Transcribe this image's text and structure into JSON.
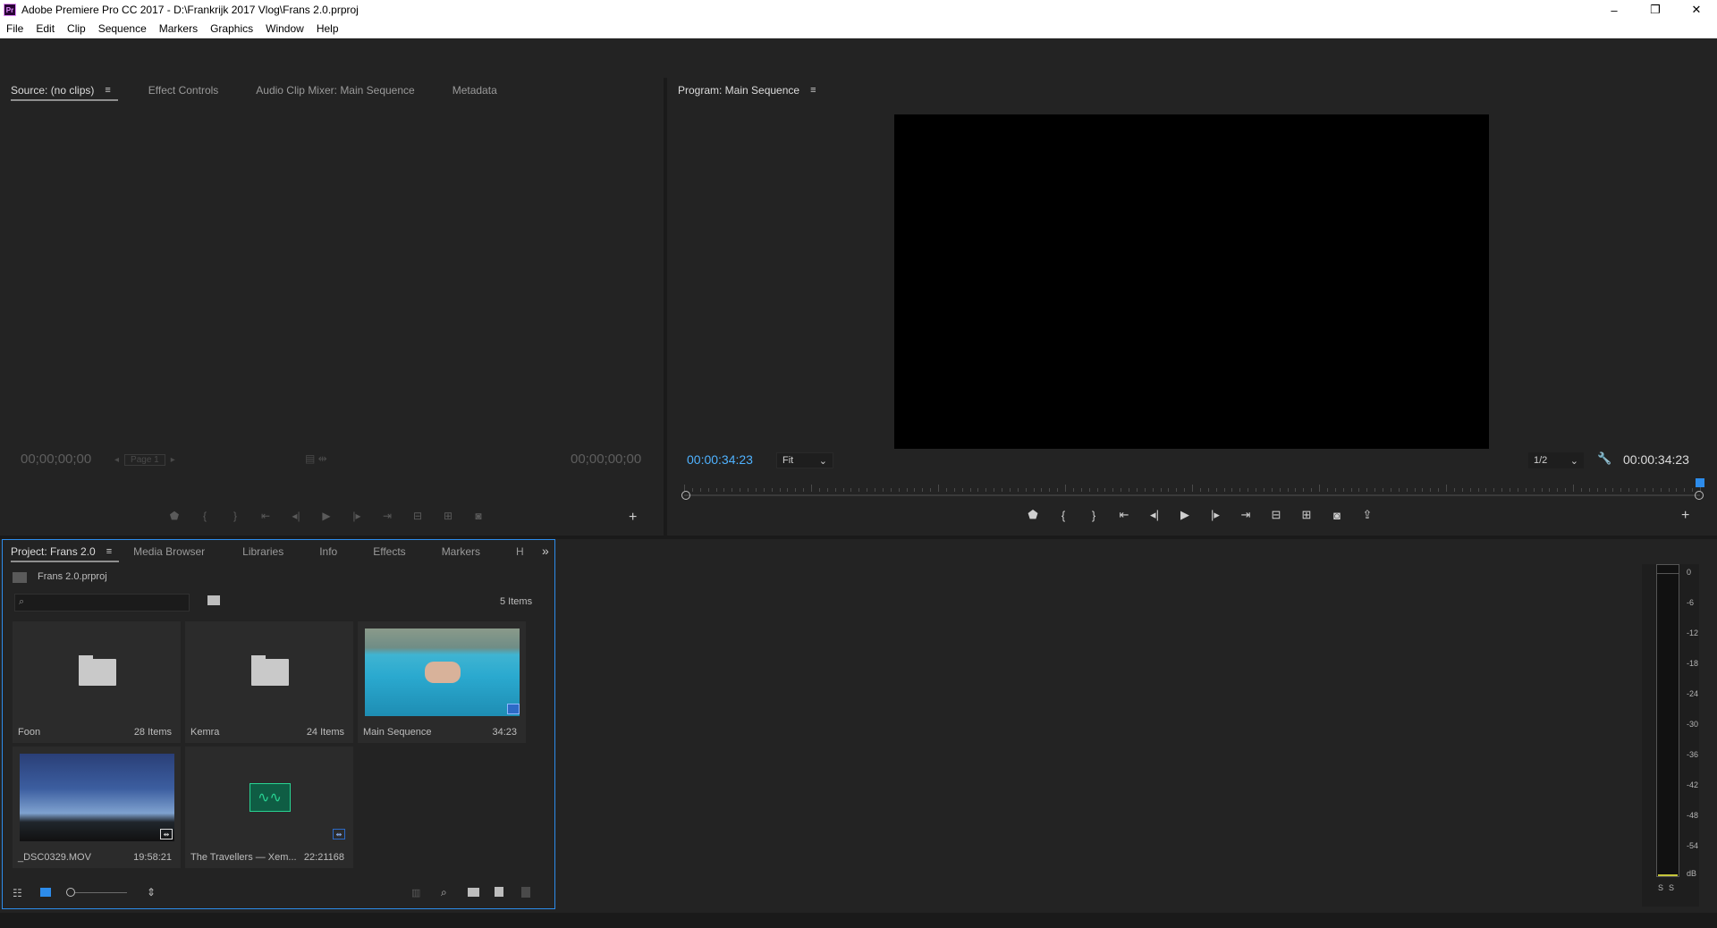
{
  "window": {
    "app_icon": "Pr",
    "title": "Adobe Premiere Pro CC 2017 - D:\\Frankrijk 2017 Vlog\\Frans 2.0.prproj",
    "minimize": "–",
    "restore": "❐",
    "close": "✕"
  },
  "menu": [
    "File",
    "Edit",
    "Clip",
    "Sequence",
    "Markers",
    "Graphics",
    "Window",
    "Help"
  ],
  "source": {
    "tabs": [
      "Source: (no clips)",
      "Effect Controls",
      "Audio Clip Mixer: Main Sequence",
      "Metadata"
    ],
    "timecode_left": "00;00;00;00",
    "timecode_right": "00;00;00;00",
    "page": "Page 1",
    "add": "+"
  },
  "program": {
    "tab": "Program: Main Sequence",
    "timecode_left": "00:00:34:23",
    "timecode_right": "00:00:34:23",
    "fit": "Fit",
    "resolution": "1/2",
    "add": "+"
  },
  "project": {
    "tabs": [
      "Project: Frans 2.0",
      "Media Browser",
      "Libraries",
      "Info",
      "Effects",
      "Markers",
      "H"
    ],
    "overflow": "»",
    "file": "Frans 2.0.prproj",
    "item_count": "5 Items",
    "items": [
      {
        "name": "Foon",
        "meta": "28 Items",
        "kind": "folder"
      },
      {
        "name": "Kemra",
        "meta": "24 Items",
        "kind": "folder"
      },
      {
        "name": "Main Sequence",
        "meta": "34:23",
        "kind": "sequence"
      },
      {
        "name": "_DSC0329.MOV",
        "meta": "19:58:21",
        "kind": "video"
      },
      {
        "name": "The Travellers — Xem...",
        "meta": "22:21168",
        "kind": "audio"
      }
    ]
  },
  "meter": {
    "labels": [
      "0",
      "-6",
      "-12",
      "-18",
      "-24",
      "-30",
      "-36",
      "-42",
      "-48",
      "-54",
      "dB"
    ],
    "solo": [
      "S",
      "S"
    ]
  },
  "colors": {
    "accent_blue": "#2d8ceb",
    "timecode_blue": "#4fb2ff",
    "panel_bg": "#232323"
  }
}
